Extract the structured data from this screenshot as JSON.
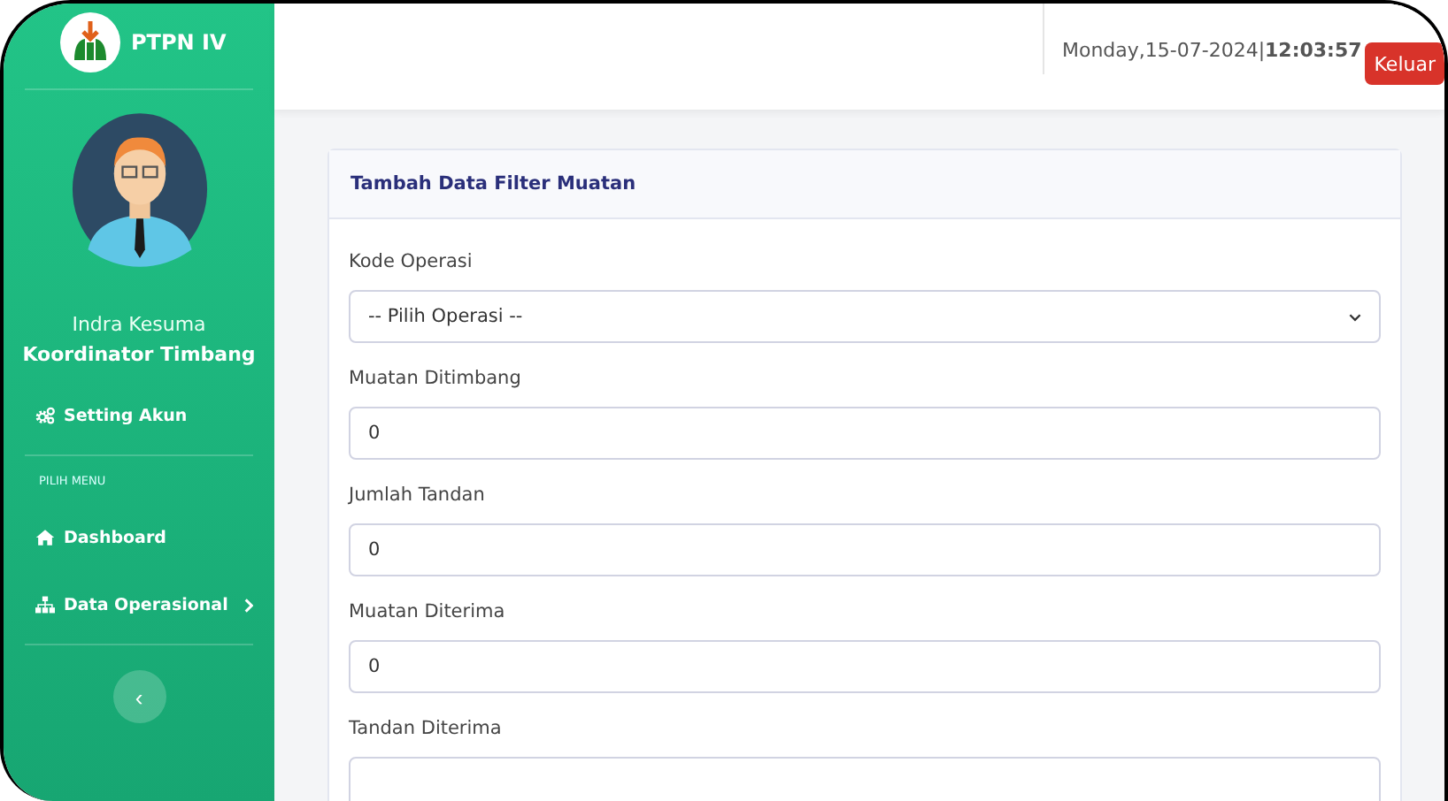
{
  "brand": {
    "name": "PTPN IV"
  },
  "user": {
    "name": "Indra Kesuma",
    "role": "Koordinator Timbang"
  },
  "sidebar": {
    "items": [
      {
        "kind": "item",
        "label": "Setting Akun",
        "has_submenu": false
      },
      {
        "kind": "heading",
        "label": "PILIH MENU"
      },
      {
        "kind": "item",
        "label": "Dashboard",
        "has_submenu": false
      },
      {
        "kind": "item",
        "label": "Data Operasional",
        "has_submenu": true
      }
    ],
    "toggle": "‹"
  },
  "topbar": {
    "date": "Monday,15-07-2024|",
    "time": "12:03:57",
    "logout": "Keluar"
  },
  "card": {
    "title": "Tambah Data Filter Muatan",
    "fields": [
      {
        "kind": "select",
        "label": "Kode Operasi",
        "value": "-- Pilih Operasi --"
      },
      {
        "kind": "input",
        "label": "Muatan Ditimbang",
        "value": "0"
      },
      {
        "kind": "input",
        "label": "Jumlah Tandan",
        "value": "0"
      },
      {
        "kind": "input",
        "label": "Muatan Diterima",
        "value": "0"
      },
      {
        "kind": "input",
        "label": "Tandan Diterima"
      }
    ]
  }
}
